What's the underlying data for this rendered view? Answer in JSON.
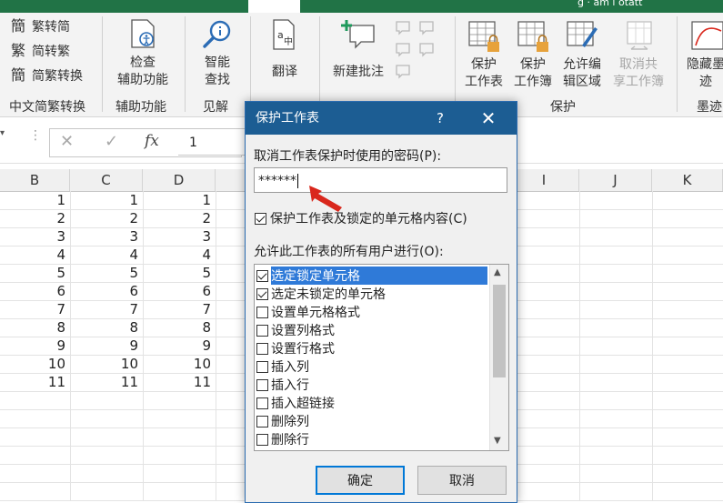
{
  "ribbon": {
    "top_right_text": "g · am i otatt",
    "chinese_convert": {
      "items": [
        {
          "icon": "簡",
          "label": "繁转简"
        },
        {
          "icon": "繁",
          "label": "简转繁"
        },
        {
          "icon": "簡",
          "label": "简繁转换"
        }
      ],
      "group_label": "中文简繁转换"
    },
    "check_assist": {
      "line1": "检查",
      "line2": "辅助功能",
      "group_label": "辅助功能"
    },
    "smart_lookup": {
      "line1": "智能",
      "line2": "查找",
      "group_label": "见解"
    },
    "translate": {
      "label": "翻译"
    },
    "new_comment": {
      "label": "新建批注"
    },
    "protect_sheet": {
      "line1": "保护",
      "line2": "工作表"
    },
    "protect_workbook": {
      "line1": "保护",
      "line2": "工作簿"
    },
    "allow_edit": {
      "line1": "允许编",
      "line2": "辑区域"
    },
    "unshare": {
      "line1": "取消共",
      "line2": "享工作簿"
    },
    "protect_group_label": "保护",
    "track_changes": {
      "line1": "隐藏墨",
      "line2": "迹"
    },
    "ink_group_label": "墨迹"
  },
  "formula_bar": {
    "value": "1",
    "fx": "fx"
  },
  "columns": [
    "B",
    "C",
    "D",
    "I",
    "J",
    "K"
  ],
  "rows": [
    1,
    2,
    3,
    4,
    5,
    6,
    7,
    8,
    9,
    10,
    11
  ],
  "dialog": {
    "title": "保护工作表",
    "help": "?",
    "close": "✕",
    "password_label": "取消工作表保护时使用的密码(P):",
    "password_value": "******",
    "protect_locked_label": "保护工作表及锁定的单元格内容(C)",
    "protect_locked_checked": true,
    "allow_label": "允许此工作表的所有用户进行(O):",
    "options": [
      {
        "label": "选定锁定单元格",
        "checked": true,
        "selected": true
      },
      {
        "label": "选定未锁定的单元格",
        "checked": true,
        "selected": false
      },
      {
        "label": "设置单元格格式",
        "checked": false,
        "selected": false
      },
      {
        "label": "设置列格式",
        "checked": false,
        "selected": false
      },
      {
        "label": "设置行格式",
        "checked": false,
        "selected": false
      },
      {
        "label": "插入列",
        "checked": false,
        "selected": false
      },
      {
        "label": "插入行",
        "checked": false,
        "selected": false
      },
      {
        "label": "插入超链接",
        "checked": false,
        "selected": false
      },
      {
        "label": "删除列",
        "checked": false,
        "selected": false
      },
      {
        "label": "删除行",
        "checked": false,
        "selected": false
      }
    ],
    "ok": "确定",
    "cancel": "取消"
  },
  "colors": {
    "title_bar": "#1c5d93",
    "selection": "#2f7ad8",
    "excel_green": "#217346",
    "arrow": "#d9271c"
  }
}
